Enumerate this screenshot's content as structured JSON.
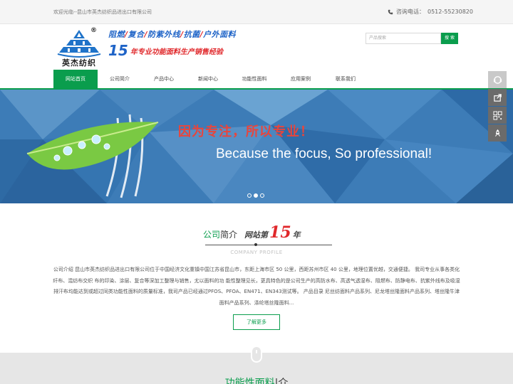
{
  "topbar": {
    "welcome": "欢迎光临--昆山市英杰纺织品进出口有限公司",
    "hotline_label": "咨询电话：",
    "hotline_number": "0512-55230820"
  },
  "logo": {
    "text": "英杰纺织",
    "reg_mark": "®"
  },
  "slogan": {
    "line1": [
      "阻燃",
      "复合",
      "防紫外线",
      "抗菌",
      "户外面料"
    ],
    "line1_sep": "/",
    "years": "15",
    "line2": "年专业功能面料生产销售经验"
  },
  "search": {
    "placeholder": "产品搜索",
    "button": "搜 索"
  },
  "nav": {
    "items": [
      "网站首页",
      "公司简介",
      "产品中心",
      "新闻中心",
      "功能性面料",
      "应用案例",
      "联系我们"
    ],
    "active_index": 0
  },
  "banner": {
    "cn_text": "因为专注，所以专业！",
    "en_text": "Because the focus, So professional!",
    "slide_count": 3,
    "active_slide": 1
  },
  "intro": {
    "title_green": "公司",
    "title_dark": "简介",
    "site_label": "网站第",
    "years": "15",
    "year_unit": "年",
    "subtitle": "COMPANY PROFILE",
    "body": "公司介绍 昆山市英杰纺织品进出口有限公司位于中国经济文化重镇中国江苏省昆山市，东距上海市区 50 公里，西距苏州市区 40 公里，地理位置优越，交通便捷。 我司专业从事各类化纤布、混纺布交织 布的印染、涂层、复合等深加工整理与销售，尤以面料的功 能性整理见长，更具特色的是公司生产的高防水布、高透气透湿布、阻燃布、防静电布、抗紫外线布及吸湿排汗布均能达到或超过同类功能性面料的质量标准，我司产品已经通过PFOS、PFOA、EN471、EN343测试等。 产品目录 尼丝纺面料产品系列、尼龙塔丝隆面料产品系列、塔丝隆牛津面料产品系列、涤纶塔丝隆面料...",
    "more_button": "了解更多"
  },
  "section2": {
    "title_green": "功能性面料",
    "title_dark": "|介"
  },
  "colors": {
    "brand_green": "#0a9d4d",
    "accent_red": "#e0282b",
    "slogan_blue": "#1e63c7"
  },
  "icons": {
    "topbar": "phone-icon",
    "side": [
      "customer-service-icon",
      "share-icon",
      "qrcode-icon",
      "rocket-top-icon"
    ]
  }
}
